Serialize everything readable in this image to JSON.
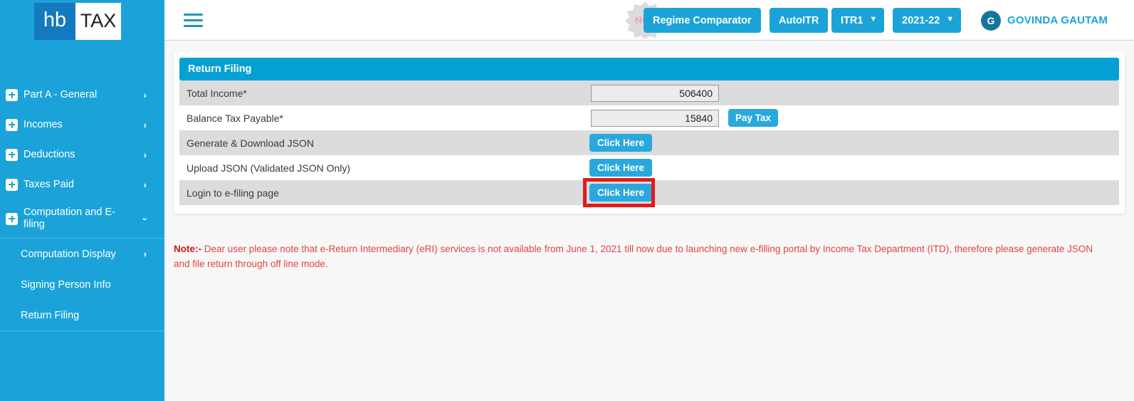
{
  "brand": {
    "logo_left": "hb",
    "logo_right": "TAX"
  },
  "sidebar": {
    "items": [
      {
        "label": "Part A - General",
        "icon": "plus-icon",
        "chevron": "chevron-right-icon"
      },
      {
        "label": "Incomes",
        "icon": "plus-icon",
        "chevron": "chevron-right-icon"
      },
      {
        "label": "Deductions",
        "icon": "plus-icon",
        "chevron": "chevron-right-icon"
      },
      {
        "label": "Taxes Paid",
        "icon": "plus-icon",
        "chevron": "chevron-right-icon"
      },
      {
        "label": "Computation and E-filing",
        "icon": "plus-icon",
        "chevron": "chevron-down-icon"
      }
    ],
    "submenu": [
      {
        "label": "Computation Display",
        "chevron": "chevron-right-icon"
      },
      {
        "label": "Signing Person Info",
        "chevron": ""
      },
      {
        "label": "Return Filing",
        "chevron": ""
      }
    ]
  },
  "header": {
    "menu_icon": "hamburger-icon",
    "new_badge": "New",
    "regime_comparator": "Regime Comparator",
    "autoitr": "AutoITR",
    "itr_form": "ITR1",
    "assessment_year": "2021-22",
    "avatar_initial": "G",
    "user_name": "GOVINDA GAUTAM"
  },
  "card": {
    "title": "Return Filing",
    "rows": [
      {
        "label": "Total Income*",
        "value": "506400",
        "control": "input"
      },
      {
        "label": "Balance Tax Payable*",
        "value": "15840",
        "control": "input",
        "button": "Pay Tax"
      },
      {
        "label": "Generate & Download JSON",
        "control": "button",
        "button": "Click Here"
      },
      {
        "label": "Upload JSON (Validated JSON Only)",
        "control": "button",
        "button": "Click Here"
      },
      {
        "label": "Login to e-filing page",
        "control": "button",
        "button": "Click Here",
        "highlighted": true
      }
    ]
  },
  "note": {
    "prefix": "Note:-",
    "text": " Dear user please note that e-Return Intermediary (eRI) services is not available from June 1, 2021 till now due to launching new e-filling portal by Income Tax Department (ITD), therefore please generate JSON and file return through off line mode."
  },
  "colors": {
    "sidebar_blue": "#1ba3d9",
    "logo_blue": "#1579bf",
    "card_header_blue": "#04a0d3",
    "button_blue": "#29a8dd",
    "highlight_red": "#e01b1b",
    "note_red": "#e2443f",
    "row_shaded": "#dcdcdc"
  }
}
